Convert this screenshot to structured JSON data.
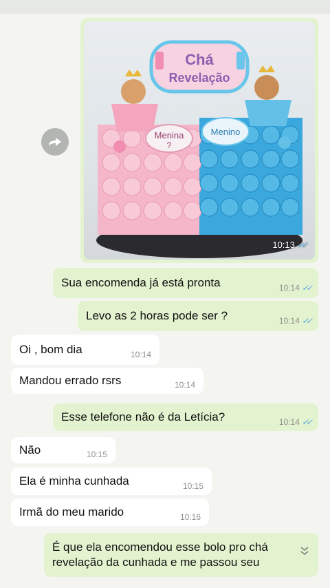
{
  "image_message": {
    "cake_topper_line1": "Chá",
    "cake_topper_line2": "Revelação",
    "left_tag": "Menina",
    "left_tag_sub": "?",
    "right_tag": "Menino",
    "time": "10:13",
    "icon": "image-photo"
  },
  "messages": [
    {
      "text": "Sua encomenda já está pronta",
      "time": "10:14"
    },
    {
      "text": "Levo as 2 horas pode ser ?",
      "time": "10:14"
    },
    {
      "text": "Oi , bom dia",
      "time": "10:14"
    },
    {
      "text": "Mandou errado rsrs",
      "time": "10:14"
    },
    {
      "text": "Esse telefone não é da Letícia?",
      "time": "10:14"
    },
    {
      "text": "Não",
      "time": "10:15"
    },
    {
      "text": "Ela é minha cunhada",
      "time": "10:15"
    },
    {
      "text": "Irmã do meu marido",
      "time": "10:16"
    },
    {
      "line1": "É que ela encomendou esse bolo pro chá",
      "line2": "revelação da cunhada e me passou seu"
    }
  ],
  "colors": {
    "outgoing": "#e3f2cf",
    "incoming": "#ffffff",
    "read_ticks": "#4aa8e0"
  }
}
